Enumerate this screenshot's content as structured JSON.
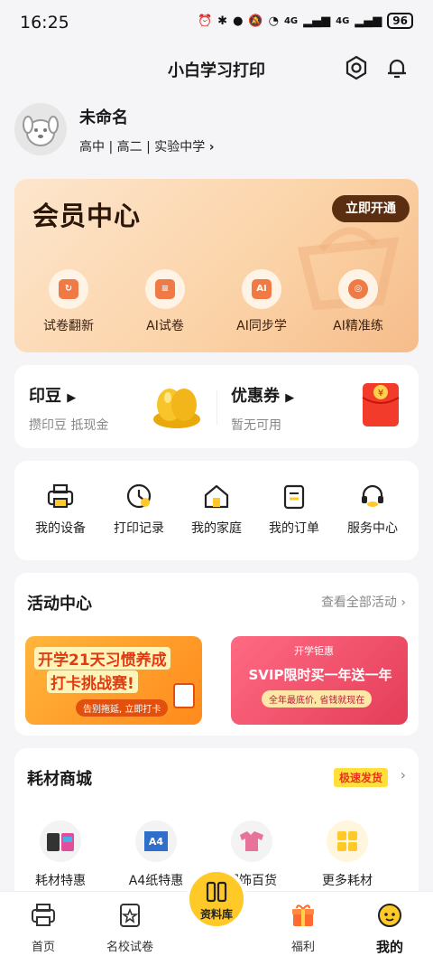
{
  "status_bar": {
    "time": "16:25",
    "battery": "96",
    "signal_1": "4G",
    "signal_2": "4G"
  },
  "app": {
    "title": "小白学习打印"
  },
  "profile": {
    "name": "未命名",
    "school": "高中 | 高二 | 实验中学"
  },
  "vip": {
    "title": "会员中心",
    "button": "立即开通",
    "items": [
      {
        "label": "试卷翻新",
        "icon": "document-refresh-icon"
      },
      {
        "label": "AI试卷",
        "icon": "document-icon"
      },
      {
        "label": "AI同步学",
        "icon": "ai-icon",
        "badge": "AI"
      },
      {
        "label": "AI精准练",
        "icon": "target-icon"
      }
    ]
  },
  "points": {
    "title": "印豆",
    "subtitle": "攒印豆 抵现金"
  },
  "coupons": {
    "title": "优惠券",
    "subtitle": "暂无可用"
  },
  "quick_actions": [
    {
      "label": "我的设备",
      "icon": "printer-icon"
    },
    {
      "label": "打印记录",
      "icon": "clock-icon"
    },
    {
      "label": "我的家庭",
      "icon": "home-icon"
    },
    {
      "label": "我的订单",
      "icon": "order-list-icon"
    },
    {
      "label": "服务中心",
      "icon": "headset-icon"
    }
  ],
  "activities": {
    "title": "活动中心",
    "more": "查看全部活动",
    "banner1": {
      "title_1": "开学21天习惯养成",
      "title_2": "打卡挑战赛!",
      "button": "告别拖延, 立即打卡"
    },
    "banner2": {
      "tag": "开学钜惠",
      "headline": "SVIP限时买一年送一年",
      "sub": "全年最底价, 省钱就现在"
    }
  },
  "shop": {
    "title": "耗材商城",
    "badge": "极速发货",
    "items": [
      {
        "label": "耗材特惠",
        "icon": "ink-cartridge-icon"
      },
      {
        "label": "A4纸特惠",
        "icon": "paper-pack-icon"
      },
      {
        "label": "服饰百货",
        "icon": "clothing-icon"
      },
      {
        "label": "更多耗材",
        "icon": "grid-icon"
      }
    ]
  },
  "tabbar": {
    "items": [
      {
        "label": "首页",
        "icon": "printer-icon"
      },
      {
        "label": "名校试卷",
        "icon": "star-document-icon"
      },
      {
        "label": "资料库",
        "icon": "book-icon"
      },
      {
        "label": "福利",
        "icon": "gift-icon"
      },
      {
        "label": "我的",
        "icon": "face-icon"
      }
    ]
  },
  "colors": {
    "accent": "#ffc928",
    "vip_brown": "#5a2e10",
    "orange": "#f07a46"
  }
}
